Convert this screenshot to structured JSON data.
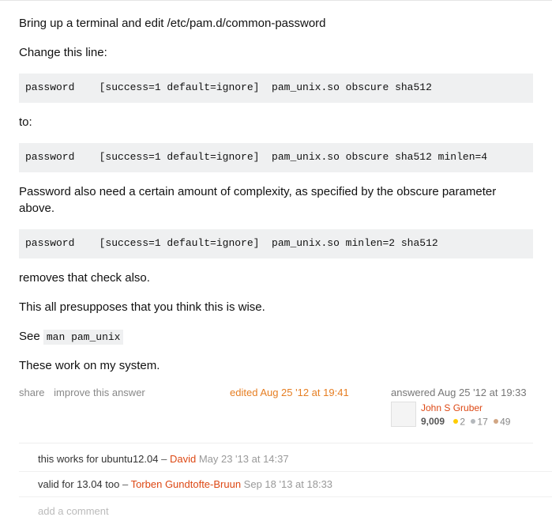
{
  "post": {
    "p1": "Bring up a terminal and edit /etc/pam.d/common-password",
    "p2": "Change this line:",
    "code1": "password    [success=1 default=ignore]  pam_unix.so obscure sha512",
    "p3": "to:",
    "code2": "password    [success=1 default=ignore]  pam_unix.so obscure sha512 minlen=4",
    "p4": "Password also need a certain amount of complexity, as specified by the obscure parameter above.",
    "code3": "password    [success=1 default=ignore]  pam_unix.so minlen=2 sha512",
    "p5": "removes that check also.",
    "p6": "This all presupposes that you think this is wise.",
    "p7a": "See ",
    "p7code": "man pam_unix",
    "p8": "These work on my system."
  },
  "menu": {
    "share": "share",
    "improve": "improve this answer"
  },
  "edit": {
    "label": "edited Aug 25 '12 at 19:41"
  },
  "answer": {
    "label": "answered Aug 25 '12 at 19:33",
    "user": "John S Gruber",
    "rep": "9,009",
    "gold": "2",
    "silver": "17",
    "bronze": "49"
  },
  "comments": [
    {
      "text": "this works for ubuntu12.04",
      "dash": " – ",
      "author": "David",
      "time": " May 23 '13 at 14:37"
    },
    {
      "text": "valid for 13.04 too",
      "dash": " – ",
      "author": "Torben Gundtofte-Bruun",
      "time": " Sep 18 '13 at 18:33"
    }
  ],
  "addComment": "add a comment"
}
